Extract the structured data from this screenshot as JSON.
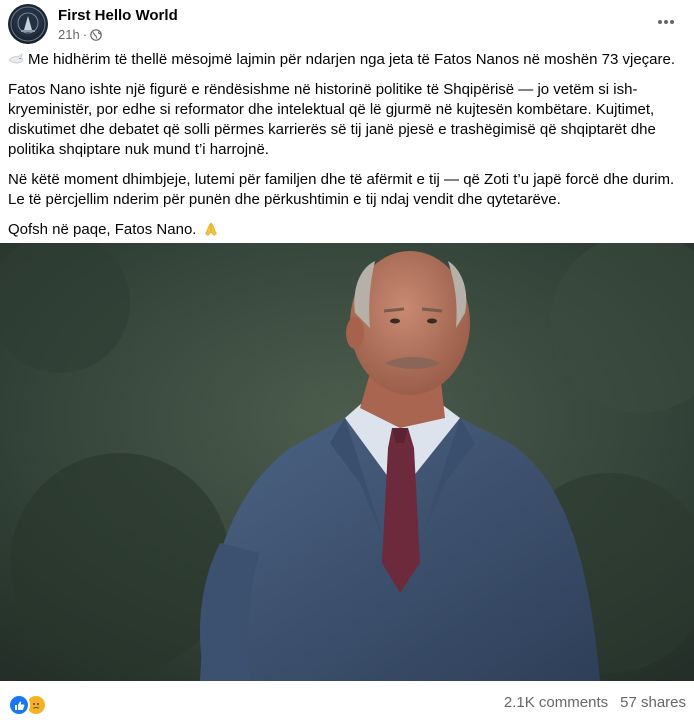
{
  "post": {
    "author": "First Hello World",
    "time": "21h",
    "privacy_icon": "globe-icon",
    "paragraphs": [
      "Me hidhërim të thellë mësojmë lajmin për ndarjen nga jeta të Fatos Nanos në moshën 73 vjeçare.",
      "Fatos Nano ishte një figurë e rëndësishme në historinë politike të Shqipërisë — jo vetëm si ish-kryeministër, por edhe si reformator dhe intelektual që lë gjurmë në kujtesën kombëtare. Kujtimet, diskutimet dhe debatet që solli përmes karrierës së tij janë pjesë e trashëgimisë që shqiptarët dhe politika shqiptare nuk mund t’i harrojnë.",
      "Në këtë moment dhimbjeje, lutemi për familjen dhe të afërmit e tij — që Zoti t’u japë forcë dhe durim. Le të përcjellim nderim për punën dhe përkushtimin e tij ndaj vendit dhe qytetarëve.",
      "Qofsh në paqe, Fatos Nano."
    ],
    "emoji": [
      "dove-emoji",
      "folded-hands-emoji"
    ],
    "image_subject": "photo of a man in a blue-grey suit and tie"
  },
  "footer": {
    "reaction_icons": [
      "like-icon",
      "sad-icon"
    ],
    "comments": "2.1K comments",
    "shares": "57 shares"
  },
  "colors": {
    "author_text": "#050505",
    "meta_text": "#65676b",
    "like_blue": "#1877f2",
    "sad_yellow": "#f7b125"
  }
}
